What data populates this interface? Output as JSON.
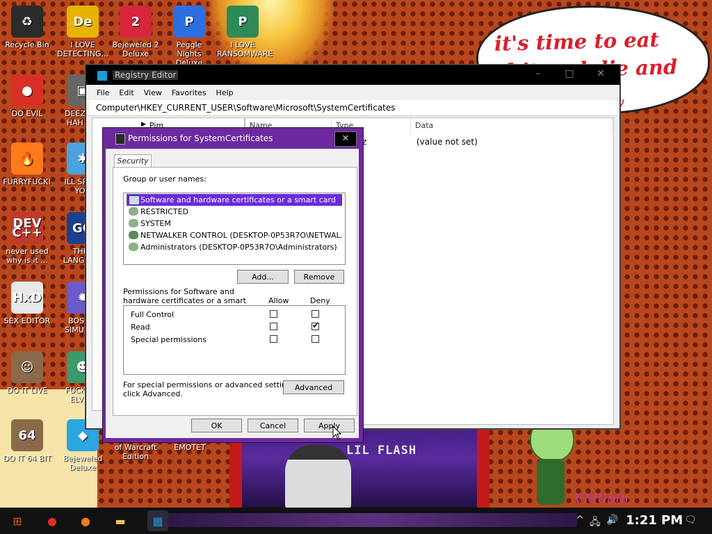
{
  "wallpaper": {
    "bubble_text": "it's time to eat shit and die and chew",
    "bubble_text_tail": "w",
    "poster_title": "LIL FLASH",
    "signature": "VM0b0t"
  },
  "desktop_icons": [
    {
      "label": "Recycle Bin",
      "glyph": "♻",
      "color": "#2b2b2b"
    },
    {
      "label": "DO EVIL",
      "glyph": "●",
      "color": "#d93025"
    },
    {
      "label": "FURRYFUCK!",
      "glyph": "🔥",
      "color": "#ff7a1a"
    },
    {
      "label": "never used why is it ...",
      "glyph": "DEV C++",
      "color": "#c0392b"
    },
    {
      "label": "SEX EDITOR",
      "glyph": "HxD",
      "color": "#e8e8e8"
    },
    {
      "label": "DO IT LIVE",
      "glyph": "☺",
      "color": "#8a6a4a"
    },
    {
      "label": "DO IT 64 BIT",
      "glyph": "64",
      "color": "#8a6a4a"
    },
    {
      "label": "I LOVE DETECTING...",
      "glyph": "De",
      "color": "#e8b200"
    },
    {
      "label": "DEEZ N... HAH G...",
      "glyph": "▣",
      "color": "#666"
    },
    {
      "label": "ILL SPY ... YOU",
      "glyph": "✱",
      "color": "#4aa3df"
    },
    {
      "label": "THI... LANGUA...",
      "glyph": "GO",
      "color": "#1d3f8f"
    },
    {
      "label": "BOSN... SIMULA...",
      "glyph": "✹",
      "color": "#6a5acd"
    },
    {
      "label": "FUCK S... ELVE...",
      "glyph": "☻",
      "color": "#3a9a6a"
    },
    {
      "label": "Bejeweled Deluxe",
      "glyph": "◆",
      "color": "#2aa6e0"
    },
    {
      "label": "Bejeweled 2 Deluxe",
      "glyph": "2",
      "color": "#d7263d"
    },
    {
      "label": "Peggle Nights Deluxe",
      "glyph": "P",
      "color": "#2d6fe0"
    },
    {
      "label": "I LOVE RANSOMWARE",
      "glyph": "P",
      "color": "#2e8b57"
    },
    {
      "label": "Peggle World of Warcraft Edition",
      "glyph": "",
      "color": "transparent"
    },
    {
      "label": "I LOVE EMOTET",
      "glyph": "",
      "color": "transparent"
    }
  ],
  "regedit": {
    "title": "Registry Editor",
    "menus": [
      "File",
      "Edit",
      "View",
      "Favorites",
      "Help"
    ],
    "address": "Computer\\HKEY_CURRENT_USER\\Software\\Microsoft\\SystemCertificates",
    "tree_node": "Pim",
    "columns": [
      "Name",
      "Type",
      "Data"
    ],
    "row_value": "(value not set)",
    "row_type_fragment": "z",
    "controls": {
      "minimize": "–",
      "maximize": "□",
      "close": "✕"
    }
  },
  "permissions": {
    "title": "Permissions for SystemCertificates",
    "close": "✕",
    "tab": "Security",
    "group_label": "Group or user names:",
    "users": [
      {
        "name": "Software and hardware certificates or a smart card",
        "selected": true
      },
      {
        "name": "RESTRICTED",
        "selected": false
      },
      {
        "name": "SYSTEM",
        "selected": false
      },
      {
        "name": "NETWALKER CONTROL (DESKTOP-0P53R7O\\NETWAL...",
        "selected": false
      },
      {
        "name": "Administrators (DESKTOP-0P53R7O\\Administrators)",
        "selected": false
      }
    ],
    "add_label": "Add...",
    "remove_label": "Remove",
    "perms_for_line1": "Permissions for Software and",
    "perms_for_line2": "hardware certificates or a smart",
    "allow_header": "Allow",
    "deny_header": "Deny",
    "rows": [
      {
        "name": "Full Control",
        "allow": false,
        "deny": false
      },
      {
        "name": "Read",
        "allow": false,
        "deny": true
      },
      {
        "name": "Special permissions",
        "allow": false,
        "deny": false
      }
    ],
    "advanced_text_line1": "For special permissions or advanced settings,",
    "advanced_text_line2": "click Advanced.",
    "advanced_label": "Advanced",
    "ok_label": "OK",
    "cancel_label": "Cancel",
    "apply_label": "Apply"
  },
  "taskbar": {
    "clock": "1:21 PM",
    "buttons": [
      {
        "name": "start",
        "glyph": "⊞",
        "color": "#e05a1a"
      },
      {
        "name": "chrome",
        "glyph": "●",
        "color": "#d93025"
      },
      {
        "name": "firefox",
        "glyph": "●",
        "color": "#ff7a1a"
      },
      {
        "name": "file-explorer",
        "glyph": "▬",
        "color": "#f2c14e"
      },
      {
        "name": "registry-editor",
        "glyph": "▦",
        "color": "#1b9ad6"
      }
    ],
    "tray": {
      "chevron": "^",
      "network": "🖧",
      "volume": "🔊",
      "notifications": "🗨"
    }
  }
}
